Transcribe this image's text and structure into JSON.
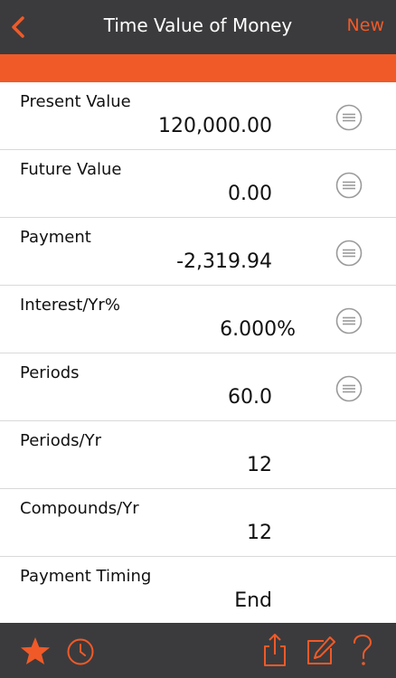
{
  "header": {
    "title": "Time Value of Money",
    "new_label": "New"
  },
  "fields": [
    {
      "label": "Present Value",
      "value": "120,000.00"
    },
    {
      "label": "Future Value",
      "value": "0.00"
    },
    {
      "label": "Payment",
      "value": "-2,319.94"
    },
    {
      "label": "Interest/Yr%",
      "value": "6.000%"
    },
    {
      "label": "Periods",
      "value": "60.0"
    },
    {
      "label": "Periods/Yr",
      "value": "12"
    },
    {
      "label": "Compounds/Yr",
      "value": "12"
    },
    {
      "label": "Payment Timing",
      "value": "End"
    }
  ],
  "icons": {
    "back": "chevron-left-icon",
    "solve": "equals-circle-icon",
    "favorites": "star-icon",
    "history": "clock-icon",
    "share": "share-icon",
    "edit": "edit-icon",
    "help": "question-icon"
  },
  "colors": {
    "accent": "#f05a28",
    "bar": "#3b3b3d",
    "icon_gray": "#9a9a9a"
  }
}
